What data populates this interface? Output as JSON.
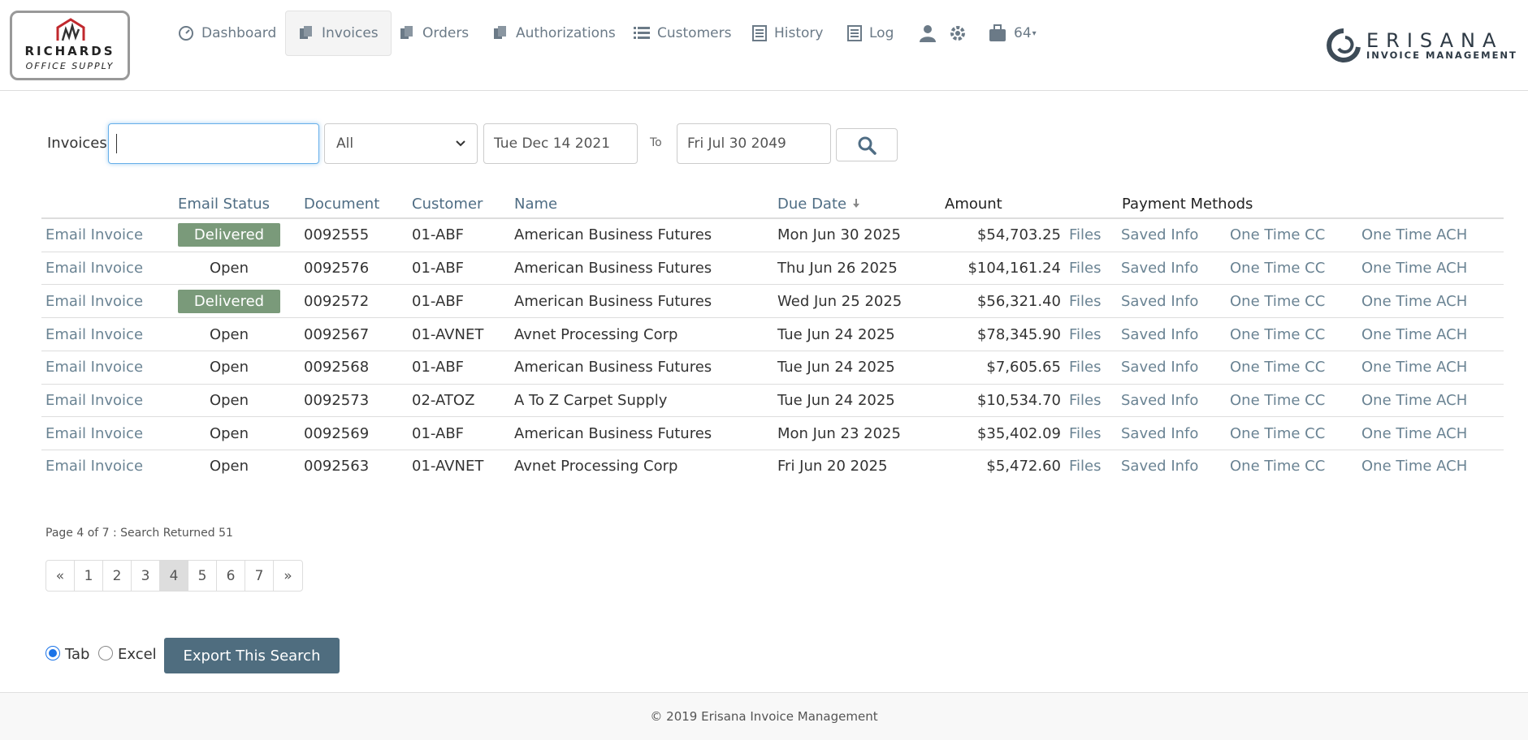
{
  "logo": {
    "line1": "RICHARDS",
    "line2": "OFFICE SUPPLY"
  },
  "nav": {
    "items": [
      {
        "label": "Dashboard",
        "icon": "dashboard-icon"
      },
      {
        "label": "Invoices",
        "icon": "documents-icon",
        "active": true
      },
      {
        "label": "Orders",
        "icon": "documents-icon"
      },
      {
        "label": "Authorizations",
        "icon": "documents-icon"
      },
      {
        "label": "Customers",
        "icon": "list-icon"
      },
      {
        "label": "History",
        "icon": "list-box-icon"
      },
      {
        "label": "Log",
        "icon": "list-box-icon"
      }
    ],
    "user_icon": "user-icon",
    "settings_icon": "gear-icon",
    "company_count": "64"
  },
  "brand": {
    "name": "ERISANA",
    "sub": "INVOICE MANAGEMENT"
  },
  "search": {
    "label": "Invoices",
    "value": "",
    "status_filter": "All",
    "date_from": "Tue Dec 14 2021",
    "to_label": "To",
    "date_to": "Fri Jul 30 2049"
  },
  "table": {
    "headers": {
      "email_status": "Email Status",
      "document": "Document",
      "customer": "Customer",
      "name": "Name",
      "due_date": "Due Date",
      "amount": "Amount",
      "payment_methods": "Payment Methods"
    },
    "rows": [
      {
        "action": "Email Invoice",
        "status": "Delivered",
        "document": "0092555",
        "customer": "01-ABF",
        "name": "American Business Futures",
        "due_date": "Mon Jun 30 2025",
        "amount": "$54,703.25",
        "files": "Files",
        "saved": "Saved Info",
        "cc": "One Time CC",
        "ach": "One Time ACH"
      },
      {
        "action": "Email Invoice",
        "status": "Open",
        "document": "0092576",
        "customer": "01-ABF",
        "name": "American Business Futures",
        "due_date": "Thu Jun 26 2025",
        "amount": "$104,161.24",
        "files": "Files",
        "saved": "Saved Info",
        "cc": "One Time CC",
        "ach": "One Time ACH"
      },
      {
        "action": "Email Invoice",
        "status": "Delivered",
        "document": "0092572",
        "customer": "01-ABF",
        "name": "American Business Futures",
        "due_date": "Wed Jun 25 2025",
        "amount": "$56,321.40",
        "files": "Files",
        "saved": "Saved Info",
        "cc": "One Time CC",
        "ach": "One Time ACH"
      },
      {
        "action": "Email Invoice",
        "status": "Open",
        "document": "0092567",
        "customer": "01-AVNET",
        "name": "Avnet Processing Corp",
        "due_date": "Tue Jun 24 2025",
        "amount": "$78,345.90",
        "files": "Files",
        "saved": "Saved Info",
        "cc": "One Time CC",
        "ach": "One Time ACH"
      },
      {
        "action": "Email Invoice",
        "status": "Open",
        "document": "0092568",
        "customer": "01-ABF",
        "name": "American Business Futures",
        "due_date": "Tue Jun 24 2025",
        "amount": "$7,605.65",
        "files": "Files",
        "saved": "Saved Info",
        "cc": "One Time CC",
        "ach": "One Time ACH"
      },
      {
        "action": "Email Invoice",
        "status": "Open",
        "document": "0092573",
        "customer": "02-ATOZ",
        "name": "A To Z Carpet Supply",
        "due_date": "Tue Jun 24 2025",
        "amount": "$10,534.70",
        "files": "Files",
        "saved": "Saved Info",
        "cc": "One Time CC",
        "ach": "One Time ACH"
      },
      {
        "action": "Email Invoice",
        "status": "Open",
        "document": "0092569",
        "customer": "01-ABF",
        "name": "American Business Futures",
        "due_date": "Mon Jun 23 2025",
        "amount": "$35,402.09",
        "files": "Files",
        "saved": "Saved Info",
        "cc": "One Time CC",
        "ach": "One Time ACH"
      },
      {
        "action": "Email Invoice",
        "status": "Open",
        "document": "0092563",
        "customer": "01-AVNET",
        "name": "Avnet Processing Corp",
        "due_date": "Fri Jun 20 2025",
        "amount": "$5,472.60",
        "files": "Files",
        "saved": "Saved Info",
        "cc": "One Time CC",
        "ach": "One Time ACH"
      }
    ]
  },
  "pagination": {
    "info": "Page 4 of 7 : Search Returned 51",
    "prev": "«",
    "next": "»",
    "pages": [
      "1",
      "2",
      "3",
      "4",
      "5",
      "6",
      "7"
    ],
    "current": "4"
  },
  "export": {
    "tab_label": "Tab",
    "excel_label": "Excel",
    "button_label": "Export This Search",
    "selected": "Tab"
  },
  "footer": {
    "text": "© 2019 Erisana Invoice Management"
  },
  "colors": {
    "link": "#6a8393",
    "header_link": "#4f6d84",
    "delivered_badge": "#7a9a7a",
    "export_button": "#4f6d7f"
  }
}
